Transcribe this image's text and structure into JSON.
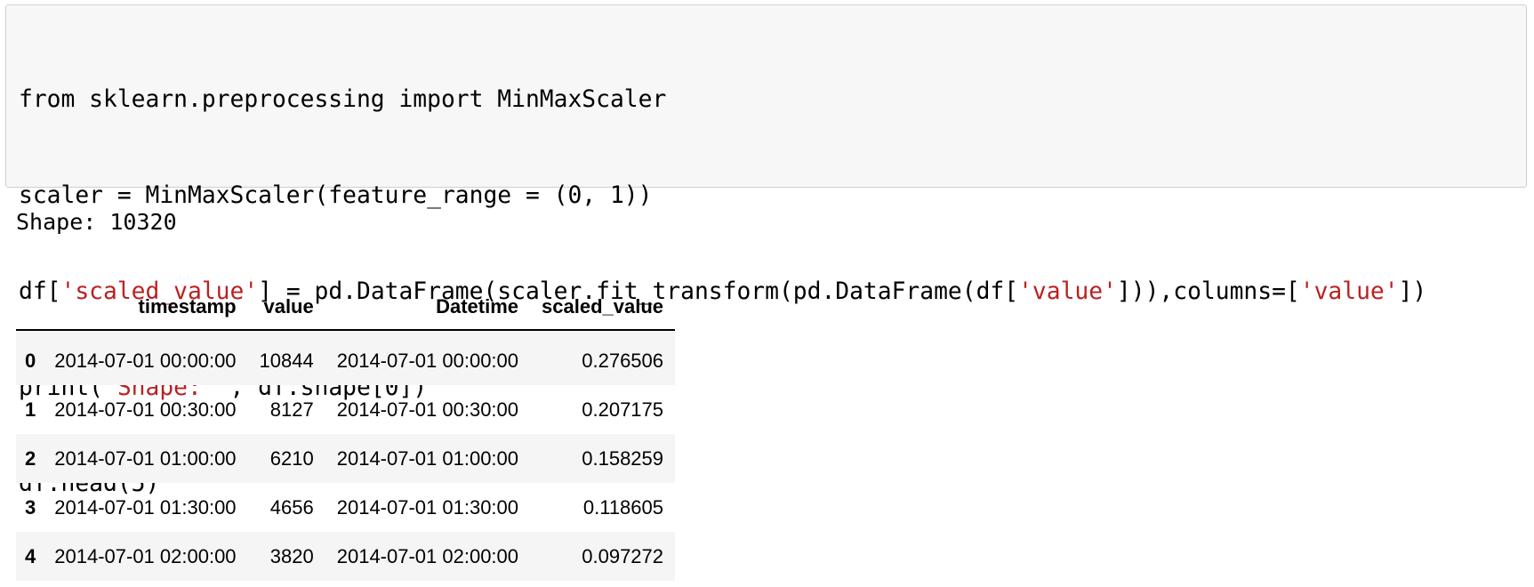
{
  "code_cell": {
    "lines": [
      "from sklearn.preprocessing import MinMaxScaler",
      "scaler = MinMaxScaler(feature_range = (0, 1))",
      "df['scaled_value'] = pd.DataFrame(scaler.fit_transform(pd.DataFrame(df['value'])),columns=['value'])",
      "print('Shape:' , df.shape[0])",
      "df.head(5)"
    ]
  },
  "output": {
    "stdout": "Shape: 10320"
  },
  "dataframe": {
    "columns": [
      "",
      "timestamp",
      "value",
      "Datetime",
      "scaled_value"
    ],
    "rows": [
      {
        "index": "0",
        "timestamp": "2014-07-01 00:00:00",
        "value": "10844",
        "datetime": "2014-07-01 00:00:00",
        "scaled_value": "0.276506"
      },
      {
        "index": "1",
        "timestamp": "2014-07-01 00:30:00",
        "value": "8127",
        "datetime": "2014-07-01 00:30:00",
        "scaled_value": "0.207175"
      },
      {
        "index": "2",
        "timestamp": "2014-07-01 01:00:00",
        "value": "6210",
        "datetime": "2014-07-01 01:00:00",
        "scaled_value": "0.158259"
      },
      {
        "index": "3",
        "timestamp": "2014-07-01 01:30:00",
        "value": "4656",
        "datetime": "2014-07-01 01:30:00",
        "scaled_value": "0.118605"
      },
      {
        "index": "4",
        "timestamp": "2014-07-01 02:00:00",
        "value": "3820",
        "datetime": "2014-07-01 02:00:00",
        "scaled_value": "0.097272"
      }
    ]
  },
  "colors": {
    "cell_background": "#f7f7f7",
    "cell_border": "#cfcfcf",
    "string_literal": "#ba2121",
    "row_stripe": "#f5f5f5"
  }
}
